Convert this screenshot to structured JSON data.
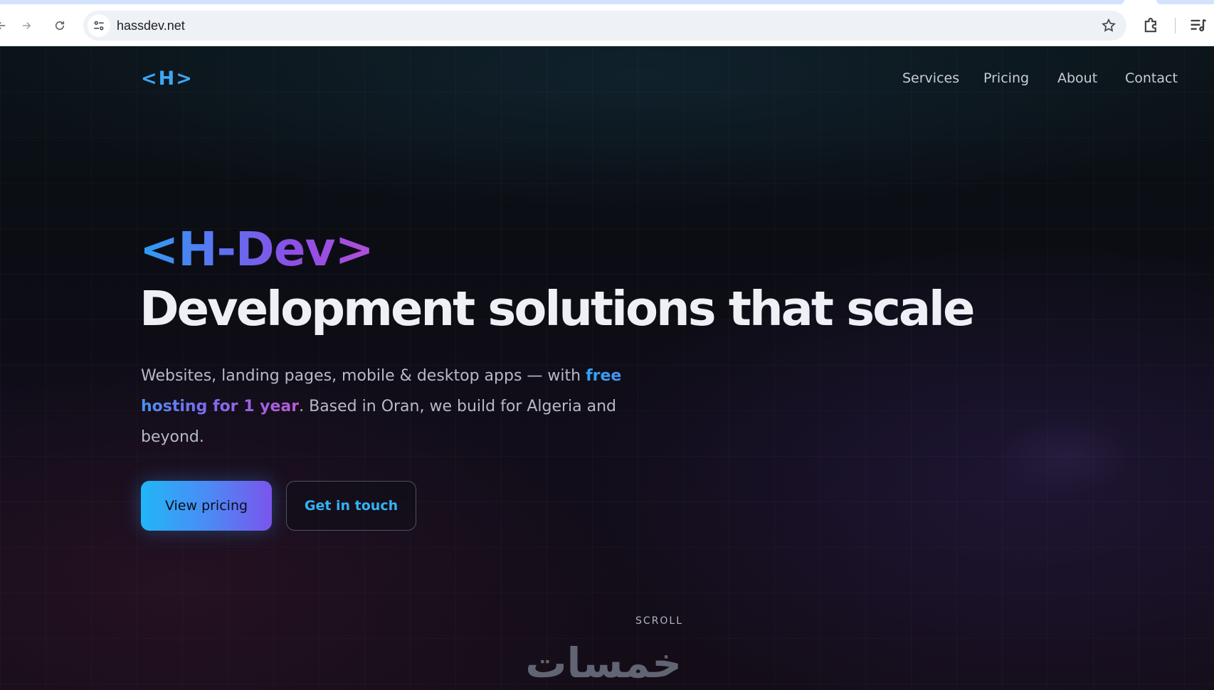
{
  "browser": {
    "url": "hassdev.net",
    "icons": {
      "back": "arrow-left-icon",
      "forward": "arrow-right-icon",
      "reload": "reload-icon",
      "site_info": "site-settings-icon",
      "bookmark": "star-icon",
      "extensions": "puzzle-icon",
      "media": "media-control-icon"
    }
  },
  "header": {
    "logo": "<H>",
    "nav": [
      "Services",
      "Pricing",
      "About",
      "Contact"
    ]
  },
  "hero": {
    "brand": "<H-Dev>",
    "headline": "Development solutions that scale",
    "lead_before": "Websites, landing pages, mobile & desktop apps — with ",
    "lead_highlight": "free hosting for 1 year",
    "lead_after": ". Based in Oran, we build for Algeria and beyond.",
    "primary_button": "View pricing",
    "secondary_button": "Get in touch"
  },
  "scroll_label": "SCROLL",
  "watermark": "خمسات",
  "colors": {
    "accent_blue": "#2c9ff5",
    "accent_purple": "#8b4fe6",
    "background": "#0b0d13"
  }
}
